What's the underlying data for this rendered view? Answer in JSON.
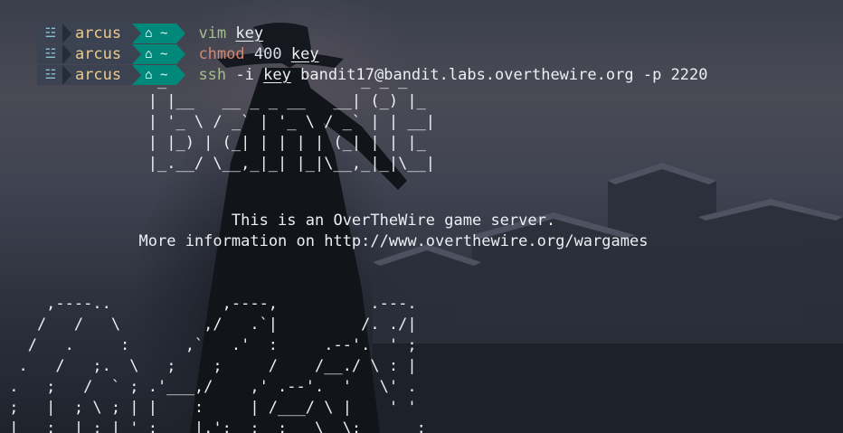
{
  "prompt": {
    "os_icon": "☳",
    "user": "arcus",
    "dir": "⌂ ~"
  },
  "history": [
    {
      "cmd": "vim",
      "args": [
        {
          "t": "key",
          "u": true
        }
      ]
    },
    {
      "cmd": "chmod",
      "args": [
        {
          "t": "400",
          "u": false,
          "num": true
        },
        {
          "t": "key",
          "u": true
        }
      ]
    },
    {
      "cmd": "ssh",
      "args": [
        {
          "t": "-i",
          "u": false
        },
        {
          "t": "key",
          "u": true
        },
        {
          "t": "bandit17@bandit.labs.overthewire.org",
          "u": false
        },
        {
          "t": "-p",
          "u": false
        },
        {
          "t": "2220",
          "u": false
        }
      ]
    }
  ],
  "banner": {
    "logo": "                 _                     _ _ _\n                | |__   __ _ _ __   __| (_) |_\n                | '_ \\ / _` | '_ \\ / _` | | __|\n                | |_) | (_| | | | | (_| | | |_\n                |_.__/ \\__,_|_| |_|\\__,_|_|\\__|",
    "welcome_line1": "This is an OverTheWire game server.",
    "welcome_line2": "More information on http://www.overthewire.org/wargames",
    "art": "     ,----..            ,----,          .---.\n    /   /   \\         ,/   .`|         /. ./|\n   /   .     :      ,`   .'  :     .--'.  ' ;\n  .   /   ;.  \\   ;    ;     /    /__./ \\ : |\n .   ;   /  ` ; .'___,/    ,' .--'.  '   \\' .\n ;   |  ; \\ ; | |    :     | /___/ \\ |    ' '\n |   :  | ; | ' ;    |.';  ;  ;   \\  \\;      :"
  }
}
